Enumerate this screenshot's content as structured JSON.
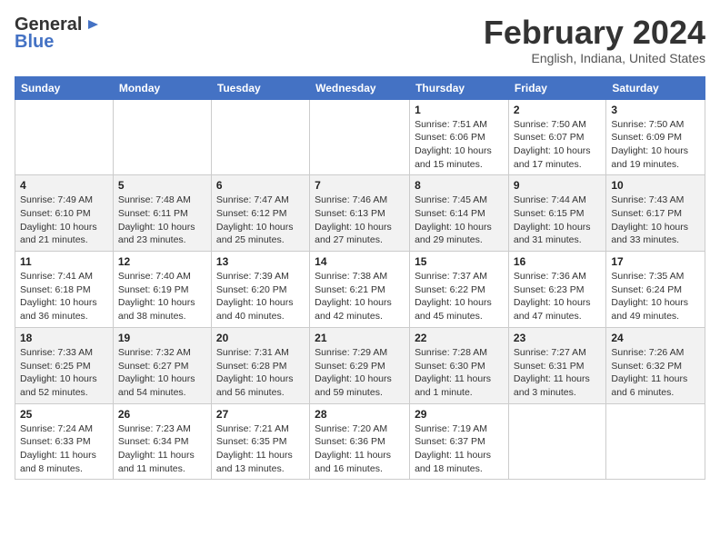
{
  "header": {
    "logo_general": "General",
    "logo_blue": "Blue",
    "month_title": "February 2024",
    "location": "English, Indiana, United States"
  },
  "days_of_week": [
    "Sunday",
    "Monday",
    "Tuesday",
    "Wednesday",
    "Thursday",
    "Friday",
    "Saturday"
  ],
  "weeks": [
    [
      {
        "day": "",
        "info": ""
      },
      {
        "day": "",
        "info": ""
      },
      {
        "day": "",
        "info": ""
      },
      {
        "day": "",
        "info": ""
      },
      {
        "day": "1",
        "info": "Sunrise: 7:51 AM\nSunset: 6:06 PM\nDaylight: 10 hours\nand 15 minutes."
      },
      {
        "day": "2",
        "info": "Sunrise: 7:50 AM\nSunset: 6:07 PM\nDaylight: 10 hours\nand 17 minutes."
      },
      {
        "day": "3",
        "info": "Sunrise: 7:50 AM\nSunset: 6:09 PM\nDaylight: 10 hours\nand 19 minutes."
      }
    ],
    [
      {
        "day": "4",
        "info": "Sunrise: 7:49 AM\nSunset: 6:10 PM\nDaylight: 10 hours\nand 21 minutes."
      },
      {
        "day": "5",
        "info": "Sunrise: 7:48 AM\nSunset: 6:11 PM\nDaylight: 10 hours\nand 23 minutes."
      },
      {
        "day": "6",
        "info": "Sunrise: 7:47 AM\nSunset: 6:12 PM\nDaylight: 10 hours\nand 25 minutes."
      },
      {
        "day": "7",
        "info": "Sunrise: 7:46 AM\nSunset: 6:13 PM\nDaylight: 10 hours\nand 27 minutes."
      },
      {
        "day": "8",
        "info": "Sunrise: 7:45 AM\nSunset: 6:14 PM\nDaylight: 10 hours\nand 29 minutes."
      },
      {
        "day": "9",
        "info": "Sunrise: 7:44 AM\nSunset: 6:15 PM\nDaylight: 10 hours\nand 31 minutes."
      },
      {
        "day": "10",
        "info": "Sunrise: 7:43 AM\nSunset: 6:17 PM\nDaylight: 10 hours\nand 33 minutes."
      }
    ],
    [
      {
        "day": "11",
        "info": "Sunrise: 7:41 AM\nSunset: 6:18 PM\nDaylight: 10 hours\nand 36 minutes."
      },
      {
        "day": "12",
        "info": "Sunrise: 7:40 AM\nSunset: 6:19 PM\nDaylight: 10 hours\nand 38 minutes."
      },
      {
        "day": "13",
        "info": "Sunrise: 7:39 AM\nSunset: 6:20 PM\nDaylight: 10 hours\nand 40 minutes."
      },
      {
        "day": "14",
        "info": "Sunrise: 7:38 AM\nSunset: 6:21 PM\nDaylight: 10 hours\nand 42 minutes."
      },
      {
        "day": "15",
        "info": "Sunrise: 7:37 AM\nSunset: 6:22 PM\nDaylight: 10 hours\nand 45 minutes."
      },
      {
        "day": "16",
        "info": "Sunrise: 7:36 AM\nSunset: 6:23 PM\nDaylight: 10 hours\nand 47 minutes."
      },
      {
        "day": "17",
        "info": "Sunrise: 7:35 AM\nSunset: 6:24 PM\nDaylight: 10 hours\nand 49 minutes."
      }
    ],
    [
      {
        "day": "18",
        "info": "Sunrise: 7:33 AM\nSunset: 6:25 PM\nDaylight: 10 hours\nand 52 minutes."
      },
      {
        "day": "19",
        "info": "Sunrise: 7:32 AM\nSunset: 6:27 PM\nDaylight: 10 hours\nand 54 minutes."
      },
      {
        "day": "20",
        "info": "Sunrise: 7:31 AM\nSunset: 6:28 PM\nDaylight: 10 hours\nand 56 minutes."
      },
      {
        "day": "21",
        "info": "Sunrise: 7:29 AM\nSunset: 6:29 PM\nDaylight: 10 hours\nand 59 minutes."
      },
      {
        "day": "22",
        "info": "Sunrise: 7:28 AM\nSunset: 6:30 PM\nDaylight: 11 hours\nand 1 minute."
      },
      {
        "day": "23",
        "info": "Sunrise: 7:27 AM\nSunset: 6:31 PM\nDaylight: 11 hours\nand 3 minutes."
      },
      {
        "day": "24",
        "info": "Sunrise: 7:26 AM\nSunset: 6:32 PM\nDaylight: 11 hours\nand 6 minutes."
      }
    ],
    [
      {
        "day": "25",
        "info": "Sunrise: 7:24 AM\nSunset: 6:33 PM\nDaylight: 11 hours\nand 8 minutes."
      },
      {
        "day": "26",
        "info": "Sunrise: 7:23 AM\nSunset: 6:34 PM\nDaylight: 11 hours\nand 11 minutes."
      },
      {
        "day": "27",
        "info": "Sunrise: 7:21 AM\nSunset: 6:35 PM\nDaylight: 11 hours\nand 13 minutes."
      },
      {
        "day": "28",
        "info": "Sunrise: 7:20 AM\nSunset: 6:36 PM\nDaylight: 11 hours\nand 16 minutes."
      },
      {
        "day": "29",
        "info": "Sunrise: 7:19 AM\nSunset: 6:37 PM\nDaylight: 11 hours\nand 18 minutes."
      },
      {
        "day": "",
        "info": ""
      },
      {
        "day": "",
        "info": ""
      }
    ]
  ]
}
